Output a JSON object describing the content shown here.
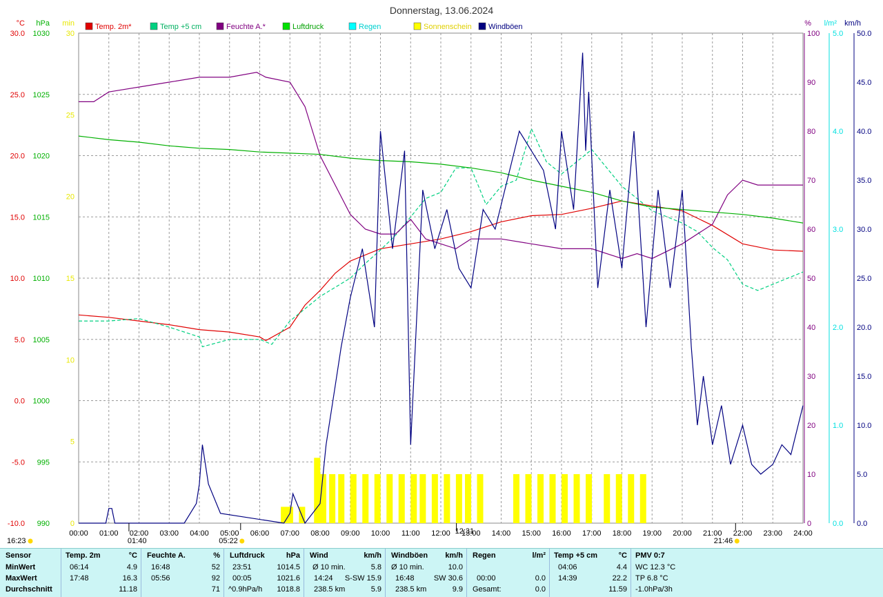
{
  "chart_data": {
    "type": "line",
    "title": "Donnerstag, 13.06.2024",
    "x_ticks": [
      "00:00",
      "01:00",
      "02:00",
      "03:00",
      "04:00",
      "05:00",
      "06:00",
      "07:00",
      "08:00",
      "09:00",
      "10:00",
      "11:00",
      "12:00",
      "13:00",
      "14:00",
      "15:00",
      "16:00",
      "17:00",
      "18:00",
      "19:00",
      "20:00",
      "21:00",
      "22:00",
      "23:00",
      "24:00"
    ],
    "xlim": [
      0,
      24
    ],
    "grid": true,
    "legend_position": "top",
    "axes": {
      "temp": {
        "unit": "°C",
        "range": [
          -10,
          30
        ],
        "ticks": [
          "30.0",
          "25.0",
          "20.0",
          "15.0",
          "10.0",
          "5.0",
          "0.0",
          "-5.0",
          "-10.0"
        ],
        "color": "#e00000"
      },
      "pressure": {
        "unit": "hPa",
        "range": [
          990,
          1030
        ],
        "ticks": [
          "1030",
          "1025",
          "1020",
          "1015",
          "1010",
          "1005",
          "1000",
          "995",
          "990"
        ],
        "color": "#00b000"
      },
      "sunshine": {
        "unit": "min",
        "range": [
          0,
          30
        ],
        "ticks": [
          "30",
          "25",
          "20",
          "15",
          "10",
          "5",
          "0"
        ],
        "color": "#e8e800"
      },
      "humidity": {
        "unit": "%",
        "range": [
          0,
          100
        ],
        "ticks": [
          "100",
          "90",
          "80",
          "70",
          "60",
          "50",
          "40",
          "30",
          "20",
          "10",
          "0"
        ],
        "color": "#800080"
      },
      "rain": {
        "unit": "l/m²",
        "range": [
          0,
          5
        ],
        "ticks": [
          "5.0",
          "4.0",
          "3.0",
          "2.0",
          "1.0",
          "0.0"
        ],
        "color": "#00e0e0"
      },
      "wind": {
        "unit": "km/h",
        "range": [
          0,
          50
        ],
        "ticks": [
          "50.0",
          "45.0",
          "40.0",
          "35.0",
          "30.0",
          "25.0",
          "20.0",
          "15.0",
          "10.0",
          "5.0",
          "0.0"
        ],
        "color": "#000080"
      }
    },
    "series": [
      {
        "name": "Temp. 2m*",
        "color": "#e00000",
        "axis": "temp",
        "style": "solid",
        "x": [
          0,
          1,
          2,
          3,
          4,
          5,
          6,
          6.2,
          7,
          7.5,
          8,
          8.5,
          9,
          10,
          11,
          12,
          13,
          14,
          15,
          16,
          17,
          18,
          19,
          20,
          21,
          22,
          23,
          24
        ],
        "y": [
          7.0,
          6.8,
          6.5,
          6.2,
          5.8,
          5.6,
          5.2,
          4.9,
          6.0,
          7.8,
          9.0,
          10.4,
          11.4,
          12.4,
          12.8,
          13.2,
          13.8,
          14.6,
          15.1,
          15.2,
          15.7,
          16.3,
          15.9,
          15.5,
          14.3,
          12.8,
          12.3,
          12.2
        ]
      },
      {
        "name": "Temp +5 cm",
        "color": "#00d080",
        "axis": "temp",
        "style": "dashed",
        "x": [
          0,
          1,
          2,
          3,
          4,
          4.1,
          5,
          6,
          6.4,
          7,
          7.5,
          8,
          9,
          9.5,
          10,
          10.5,
          11,
          11.5,
          12,
          12.5,
          13,
          13.5,
          14,
          14.5,
          15,
          15.5,
          16,
          16.5,
          17,
          17.5,
          18,
          19,
          20,
          20.5,
          21,
          21.5,
          22,
          22.5,
          23,
          24
        ],
        "y": [
          6.5,
          6.5,
          6.7,
          6.0,
          5.2,
          4.4,
          5.0,
          5.0,
          4.6,
          6.5,
          7.5,
          8.5,
          10.0,
          11.2,
          12.3,
          13.5,
          15.0,
          16.5,
          17.0,
          19.0,
          19.0,
          16.0,
          17.5,
          18.0,
          22.2,
          19.5,
          18.5,
          19.5,
          20.5,
          19.0,
          17.5,
          15.5,
          14.5,
          13.8,
          12.5,
          11.5,
          9.5,
          9.0,
          9.5,
          10.5
        ]
      },
      {
        "name": "Feuchte A.*",
        "color": "#800080",
        "axis": "humidity",
        "style": "solid",
        "x": [
          0,
          0.5,
          1,
          2,
          3,
          4,
          5,
          5.9,
          6.2,
          7,
          7.5,
          8,
          8.5,
          9,
          9.5,
          10,
          10.5,
          11,
          11.5,
          12,
          12.5,
          13,
          14,
          15,
          16,
          17,
          18,
          18.5,
          19,
          20,
          21,
          21.5,
          22,
          22.5,
          23,
          24
        ],
        "y": [
          86,
          86,
          88,
          89,
          90,
          91,
          91,
          92,
          91,
          90,
          85,
          75,
          69,
          63,
          60,
          59,
          59,
          62,
          58,
          57,
          56,
          58,
          58,
          57,
          56,
          56,
          54,
          55,
          54,
          57,
          61,
          67,
          70,
          69,
          69,
          69
        ]
      },
      {
        "name": "Luftdruck",
        "color": "#00b000",
        "axis": "pressure",
        "style": "solid",
        "x": [
          0,
          1,
          2,
          3,
          4,
          5,
          6,
          7,
          8,
          9,
          10,
          11,
          12,
          13,
          14,
          15,
          16,
          17,
          18,
          19,
          20,
          21,
          22,
          23,
          24
        ],
        "y": [
          1021.6,
          1021.3,
          1021.1,
          1020.8,
          1020.6,
          1020.5,
          1020.3,
          1020.2,
          1020.1,
          1019.8,
          1019.6,
          1019.5,
          1019.3,
          1019.0,
          1018.6,
          1018.0,
          1017.5,
          1017.0,
          1016.3,
          1015.8,
          1015.6,
          1015.4,
          1015.2,
          1014.9,
          1014.5
        ]
      },
      {
        "name": "Regen",
        "color": "#00e0e0",
        "axis": "rain",
        "x": [],
        "y": []
      },
      {
        "name": "Sonnenschein",
        "color": "#ffff00",
        "axis": "sunshine",
        "type": "bar",
        "x": [
          6.7,
          6.9,
          7.3,
          7.8,
          8.0,
          8.3,
          8.6,
          9.0,
          9.4,
          9.8,
          10.2,
          10.6,
          11.0,
          11.3,
          11.7,
          12.1,
          12.5,
          12.8,
          13.2,
          14.4,
          14.8,
          15.2,
          15.6,
          16.0,
          16.4,
          16.8,
          17.4,
          17.8,
          18.2,
          18.6
        ],
        "y": [
          1,
          1,
          1,
          4,
          3,
          3,
          3,
          3,
          3,
          3,
          3,
          3,
          3,
          3,
          3,
          3,
          3,
          3,
          3,
          3,
          3,
          3,
          3,
          3,
          3,
          3,
          3,
          3,
          3,
          3
        ]
      },
      {
        "name": "Windböen",
        "color": "#000080",
        "axis": "wind",
        "style": "solid",
        "x": [
          0,
          0.9,
          1.0,
          1.1,
          1.2,
          3.5,
          3.9,
          4.0,
          4.1,
          4.3,
          4.7,
          6.8,
          7.0,
          7.1,
          7.5,
          8.0,
          8.2,
          8.5,
          8.7,
          9.0,
          9.4,
          9.8,
          10.0,
          10.4,
          10.8,
          11.0,
          11.4,
          11.8,
          12.2,
          12.6,
          13.0,
          13.4,
          13.8,
          14.2,
          14.6,
          15.0,
          15.4,
          15.8,
          16.0,
          16.4,
          16.7,
          16.8,
          16.9,
          17.2,
          17.6,
          18.0,
          18.4,
          18.8,
          19.2,
          19.6,
          20.0,
          20.3,
          20.5,
          20.7,
          21.0,
          21.3,
          21.6,
          22.0,
          22.3,
          22.6,
          23.0,
          23.3,
          23.6,
          24.0
        ],
        "y": [
          0,
          0,
          1.5,
          1.5,
          0,
          0,
          2,
          4,
          8,
          4,
          1,
          0,
          1,
          3,
          0,
          2,
          8,
          14,
          18,
          23,
          28,
          20,
          40,
          28,
          38,
          8,
          34,
          28,
          32,
          26,
          24,
          32,
          30,
          35,
          40,
          38,
          36,
          30,
          40,
          32,
          48,
          38,
          44,
          24,
          34,
          26,
          40,
          20,
          34,
          24,
          34,
          18,
          10,
          15,
          8,
          12,
          6,
          10,
          6,
          5,
          6,
          8,
          7,
          12
        ]
      }
    ]
  },
  "legend": [
    {
      "label": "Temp. 2m*",
      "color": "#e00000",
      "text_color": "#e00000"
    },
    {
      "label": "Temp +5 cm",
      "color": "#00d080",
      "text_color": "#00b060"
    },
    {
      "label": "Feuchte A.*",
      "color": "#800080",
      "text_color": "#800080"
    },
    {
      "label": "Luftdruck",
      "color": "#00e000",
      "text_color": "#00a000"
    },
    {
      "label": "Regen",
      "color": "#00ffff",
      "text_color": "#00d0d0"
    },
    {
      "label": "Sonnenschein",
      "color": "#ffff00",
      "text_color": "#e0d000"
    },
    {
      "label": "Windböen",
      "color": "#000080",
      "text_color": "#000080"
    }
  ],
  "markers": {
    "left_time": "16:23",
    "sunrise": "05:22",
    "sunset": "21:46",
    "moonrise": "01:40",
    "moon_high": "12:31"
  },
  "stats": {
    "row_labels": [
      "Sensor",
      "MinWert",
      "MaxWert",
      "Durchschnitt"
    ],
    "temp2m": {
      "header": "Temp. 2m",
      "unit": "°C",
      "min_time": "06:14",
      "min": "4.9",
      "max_time": "17:48",
      "max": "16.3",
      "avg": "11.18"
    },
    "humidity": {
      "header": "Feuchte A.",
      "unit": "%",
      "min_time": "16:48",
      "min": "52",
      "max_time": "05:56",
      "max": "92",
      "avg": "71"
    },
    "pressure": {
      "header": "Luftdruck",
      "unit": "hPa",
      "min_time": "23:51",
      "min": "1014.5",
      "max_time": "00:05",
      "max": "1021.6",
      "trend": "^0.9hPa/h",
      "avg": "1018.8"
    },
    "wind": {
      "header": "Wind",
      "unit": "km/h",
      "r1_label": "Ø 10 min.",
      "r1_val": "5.8",
      "r2_time": "14:24",
      "r2_dir": "S-SW 15.9",
      "r3_dist": "238.5 km",
      "r3_val": "5.9"
    },
    "gusts": {
      "header": "Windböen",
      "unit": "km/h",
      "r1_label": "Ø 10 min.",
      "r1_val": "10.0",
      "r2_time": "16:48",
      "r2_dir": "SW 30.6",
      "r3_dist": "238.5 km",
      "r3_val": "9.9"
    },
    "rain": {
      "header": "Regen",
      "unit": "l/m²",
      "r2_time": "00:00",
      "r2_val": "0.0",
      "r3_label": "Gesamt:",
      "r3_val": "0.0"
    },
    "temp5": {
      "header": "Temp +5 cm",
      "unit": "°C",
      "min_time": "04:06",
      "min": "4.4",
      "max_time": "14:39",
      "max": "22.2",
      "avg": "11.59"
    },
    "pmv": {
      "header": "PMV 0:7",
      "r1": "WC 12.3 °C",
      "r2": "TP 6.8 °C",
      "r3": "-1.0hPa/3h"
    }
  }
}
